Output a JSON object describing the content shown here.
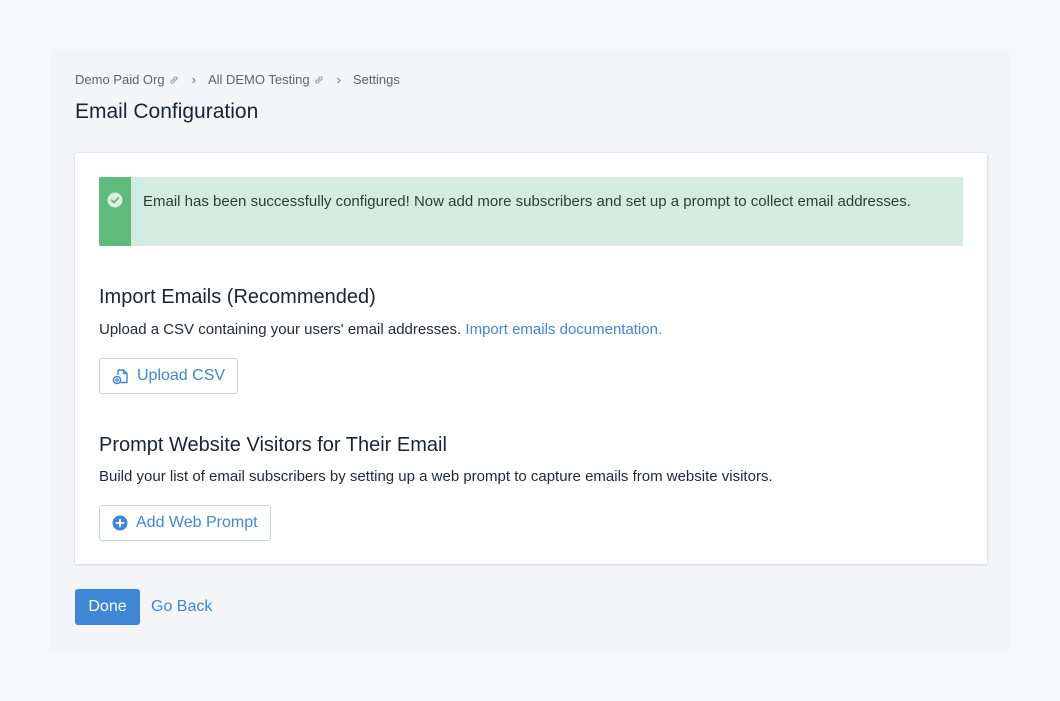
{
  "breadcrumb": {
    "items": [
      {
        "label": "Demo Paid Org",
        "icon": "link-icon"
      },
      {
        "label": "All DEMO Testing",
        "icon": "link-icon"
      },
      {
        "label": "Settings"
      }
    ],
    "separator": "›"
  },
  "page": {
    "title": "Email Configuration"
  },
  "alert": {
    "icon": "check-circle-icon",
    "text": "Email has been successfully configured! Now add more subscribers and set up a prompt to collect email addresses."
  },
  "import_section": {
    "title": "Import Emails (Recommended)",
    "description": "Upload a CSV containing your users' email addresses.",
    "doc_link": "Import emails documentation.",
    "button_label": "Upload CSV",
    "button_icon": "file-upload-icon"
  },
  "prompt_section": {
    "title": "Prompt Website Visitors for Their Email",
    "description": "Build your list of email subscribers by setting up a web prompt to capture emails from website visitors.",
    "button_label": "Add Web Prompt",
    "button_icon": "plus-circle-icon"
  },
  "footer": {
    "done_label": "Done",
    "back_label": "Go Back"
  },
  "colors": {
    "accent": "#3f86d6",
    "success_bar": "#5ebb7b",
    "success_bg": "#d3ece0"
  }
}
